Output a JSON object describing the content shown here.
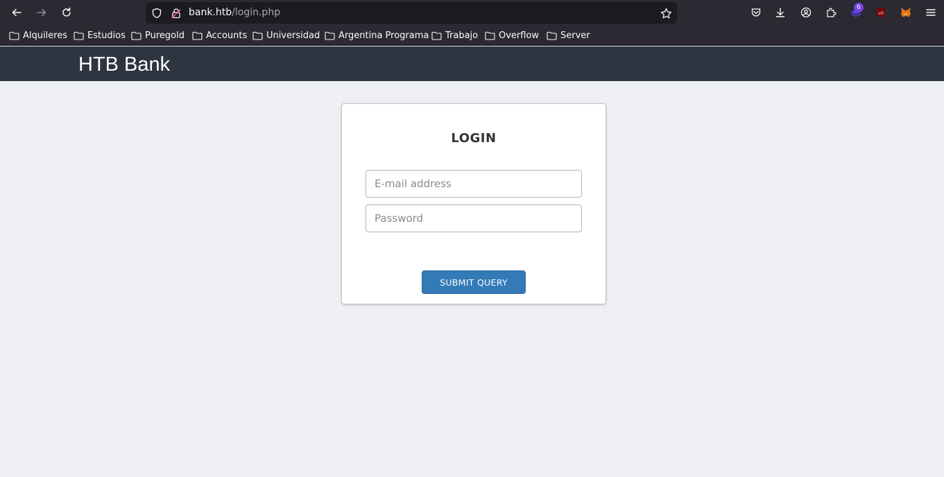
{
  "browser": {
    "url_host": "bank.htb",
    "url_path": "/login.php",
    "extension_badge": "6",
    "bookmarks": [
      "Alquileres",
      "Estudios",
      "Puregold",
      "Accounts",
      "Universidad",
      "Argentina Programa",
      "Trabajo",
      "Overflow",
      "Server"
    ]
  },
  "navbar": {
    "brand": "HTB Bank"
  },
  "login": {
    "title": "LOGIN",
    "email_placeholder": "E-mail address",
    "password_placeholder": "Password",
    "submit_label": "Submit Query"
  },
  "colors": {
    "navbar": "#2d3540",
    "page_background": "#eef0f4",
    "button": "#337ab7",
    "browser_chrome": "#2b2a33"
  }
}
